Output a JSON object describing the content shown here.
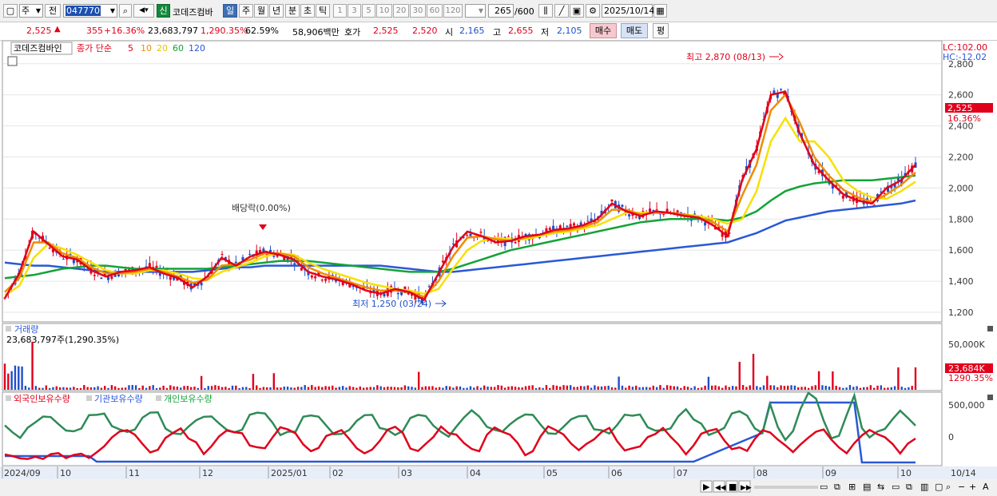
{
  "toolbar": {
    "type_select": "주",
    "jeon_label": "전",
    "code_value": "047770",
    "stock_badge": "신",
    "stock_name": "코데즈컴바",
    "periods": [
      "일",
      "주",
      "월",
      "년",
      "분",
      "초",
      "틱"
    ],
    "active_period": "일",
    "intervals": [
      "1",
      "3",
      "5",
      "10",
      "20",
      "30",
      "60",
      "120"
    ],
    "count_value": "265",
    "count_total": "/600",
    "date_value": "2025/10/14"
  },
  "quote": {
    "price": "2,525",
    "change": "355",
    "change_pct": "+16.36%",
    "volume": "23,683,797",
    "volume_ratio": "1,290.35%",
    "turnover": "62.59%",
    "amount": "58,906백만",
    "hoga_label": "호가",
    "ask": "2,525",
    "bid": "2,520",
    "open_label": "시",
    "open": "2,165",
    "high_label": "고",
    "high": "2,655",
    "low_label": "저",
    "low": "2,105",
    "buy_button": "매수",
    "sell_button": "매도",
    "avg_button": "평"
  },
  "price_panel": {
    "title": "코데즈컴바인",
    "ma_label": "종가 단순",
    "ma_periods": [
      {
        "label": "5",
        "color": "#e0001b"
      },
      {
        "label": "10",
        "color": "#f08c00"
      },
      {
        "label": "20",
        "color": "#f0d800"
      },
      {
        "label": "60",
        "color": "#13a337"
      },
      {
        "label": "120",
        "color": "#2a58d6"
      }
    ],
    "lc_label": "LC:102.00",
    "hc_label": "HC:-12.02",
    "y_ticks": [
      "2,800",
      "2,600",
      "2,400",
      "2,200",
      "2,000",
      "1,800",
      "1,600",
      "1,400",
      "1,200"
    ],
    "current_price_tag": "2,525",
    "current_pct_tag": "16.36%",
    "high_annotation": "최고 2,870 (08/13)",
    "low_annotation": "최저 1,250 (03/24)",
    "dividend_annotation": "배당락(0.00%)"
  },
  "volume_panel": {
    "title": "거래량",
    "value_label": "23,683,797주(1,290.35%)",
    "y_tick": "50,000K",
    "current_tag": "23,684K",
    "current_pct": "1290.35%"
  },
  "holdings_panel": {
    "legend": [
      {
        "label": "외국인보유수량",
        "color": "#e0001b"
      },
      {
        "label": "기관보유수량",
        "color": "#2a58d6"
      },
      {
        "label": "개인보유수량",
        "color": "#13a337"
      }
    ],
    "y_ticks": [
      "500,000",
      "0"
    ]
  },
  "x_axis": {
    "labels": [
      "2024/09",
      "10",
      "11",
      "12",
      "2025/01",
      "02",
      "03",
      "04",
      "05",
      "06",
      "07",
      "08",
      "09",
      "10"
    ],
    "right_label": "10/14"
  },
  "chart_data": {
    "type": "line",
    "x_range": [
      "2024/09",
      "2025/10/14"
    ],
    "ylim": [
      1150,
      2900
    ],
    "note_series": "price series approximated from the screenshot",
    "series": [
      {
        "name": "5",
        "values": [
          1290,
          1450,
          1720,
          1640,
          1560,
          1540,
          1470,
          1430,
          1460,
          1470,
          1490,
          1450,
          1420,
          1360,
          1430,
          1550,
          1500,
          1560,
          1590,
          1570,
          1540,
          1460,
          1430,
          1410,
          1380,
          1340,
          1320,
          1350,
          1330,
          1280,
          1450,
          1620,
          1720,
          1690,
          1650,
          1660,
          1690,
          1700,
          1730,
          1740,
          1760,
          1800,
          1900,
          1850,
          1820,
          1850,
          1840,
          1820,
          1810,
          1760,
          1690,
          2050,
          2250,
          2600,
          2620,
          2350,
          2150,
          2050,
          1960,
          1920,
          1900,
          2000,
          2050,
          2150
        ]
      },
      {
        "name": "10",
        "values": [
          1330,
          1420,
          1650,
          1650,
          1580,
          1550,
          1490,
          1450,
          1450,
          1460,
          1480,
          1460,
          1430,
          1390,
          1410,
          1500,
          1510,
          1540,
          1580,
          1580,
          1560,
          1490,
          1450,
          1420,
          1390,
          1360,
          1340,
          1340,
          1330,
          1300,
          1400,
          1560,
          1680,
          1690,
          1670,
          1660,
          1680,
          1700,
          1720,
          1730,
          1750,
          1780,
          1860,
          1860,
          1830,
          1840,
          1840,
          1830,
          1810,
          1780,
          1720,
          1950,
          2150,
          2500,
          2600,
          2420,
          2200,
          2080,
          1990,
          1940,
          1910,
          1960,
          2020,
          2100
        ]
      },
      {
        "name": "20",
        "values": [
          1310,
          1370,
          1550,
          1640,
          1610,
          1570,
          1520,
          1470,
          1450,
          1450,
          1470,
          1470,
          1450,
          1420,
          1410,
          1460,
          1490,
          1520,
          1560,
          1580,
          1570,
          1520,
          1480,
          1450,
          1420,
          1390,
          1370,
          1350,
          1340,
          1320,
          1350,
          1480,
          1600,
          1660,
          1680,
          1670,
          1670,
          1690,
          1710,
          1720,
          1740,
          1760,
          1800,
          1840,
          1840,
          1840,
          1840,
          1830,
          1820,
          1800,
          1770,
          1800,
          1980,
          2300,
          2450,
          2300,
          2300,
          2200,
          2050,
          1980,
          1940,
          1930,
          1980,
          2040
        ]
      },
      {
        "name": "60",
        "values": [
          1420,
          1430,
          1440,
          1460,
          1480,
          1490,
          1500,
          1500,
          1490,
          1480,
          1480,
          1480,
          1480,
          1480,
          1480,
          1490,
          1500,
          1510,
          1520,
          1530,
          1530,
          1530,
          1520,
          1510,
          1500,
          1490,
          1480,
          1470,
          1460,
          1460,
          1460,
          1480,
          1510,
          1540,
          1570,
          1600,
          1620,
          1640,
          1660,
          1680,
          1700,
          1720,
          1740,
          1760,
          1780,
          1790,
          1800,
          1800,
          1800,
          1800,
          1790,
          1810,
          1850,
          1920,
          1980,
          2010,
          2030,
          2040,
          2050,
          2050,
          2050,
          2060,
          2070,
          2080
        ]
      },
      {
        "name": "120",
        "values": [
          1520,
          1510,
          1500,
          1500,
          1490,
          1480,
          1470,
          1460,
          1460,
          1460,
          1460,
          1460,
          1460,
          1460,
          1470,
          1480,
          1490,
          1490,
          1500,
          1500,
          1500,
          1500,
          1500,
          1500,
          1500,
          1500,
          1500,
          1490,
          1480,
          1470,
          1460,
          1460,
          1470,
          1480,
          1490,
          1500,
          1510,
          1520,
          1530,
          1540,
          1550,
          1560,
          1570,
          1580,
          1590,
          1600,
          1610,
          1620,
          1630,
          1640,
          1650,
          1680,
          1710,
          1750,
          1790,
          1810,
          1830,
          1850,
          1860,
          1870,
          1880,
          1890,
          1900,
          1920
        ]
      }
    ]
  }
}
